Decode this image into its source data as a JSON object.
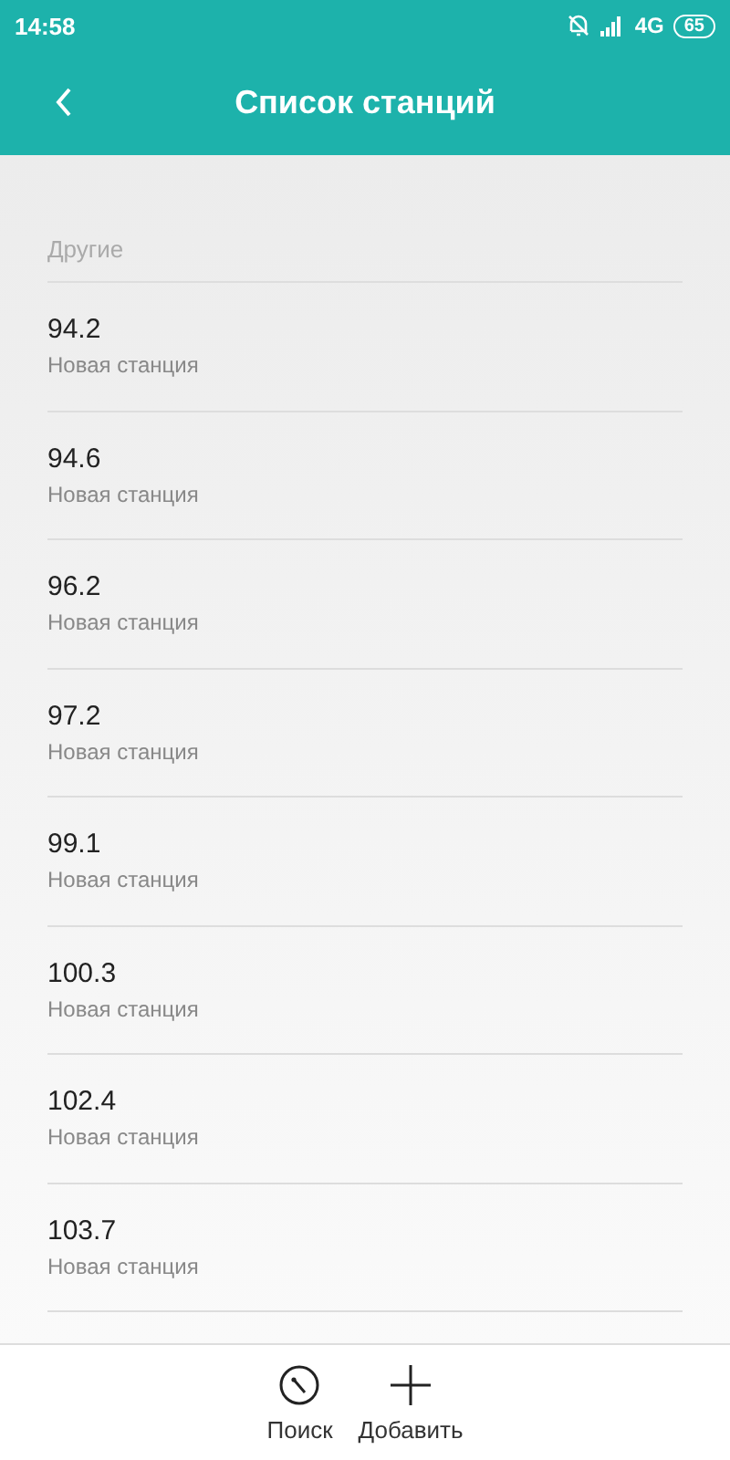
{
  "status_bar": {
    "time": "14:58",
    "network": "4G",
    "battery": "65"
  },
  "header": {
    "title": "Список станций"
  },
  "section": {
    "title": "Другие"
  },
  "stations": [
    {
      "frequency": "94.2",
      "name": "Новая станция"
    },
    {
      "frequency": "94.6",
      "name": "Новая станция"
    },
    {
      "frequency": "96.2",
      "name": "Новая станция"
    },
    {
      "frequency": "97.2",
      "name": "Новая станция"
    },
    {
      "frequency": "99.1",
      "name": "Новая станция"
    },
    {
      "frequency": "100.3",
      "name": "Новая станция"
    },
    {
      "frequency": "102.4",
      "name": "Новая станция"
    },
    {
      "frequency": "103.7",
      "name": "Новая станция"
    }
  ],
  "toolbar": [
    {
      "kind": "scan",
      "label": "Поиск"
    },
    {
      "kind": "add",
      "label": "Добавить"
    }
  ]
}
